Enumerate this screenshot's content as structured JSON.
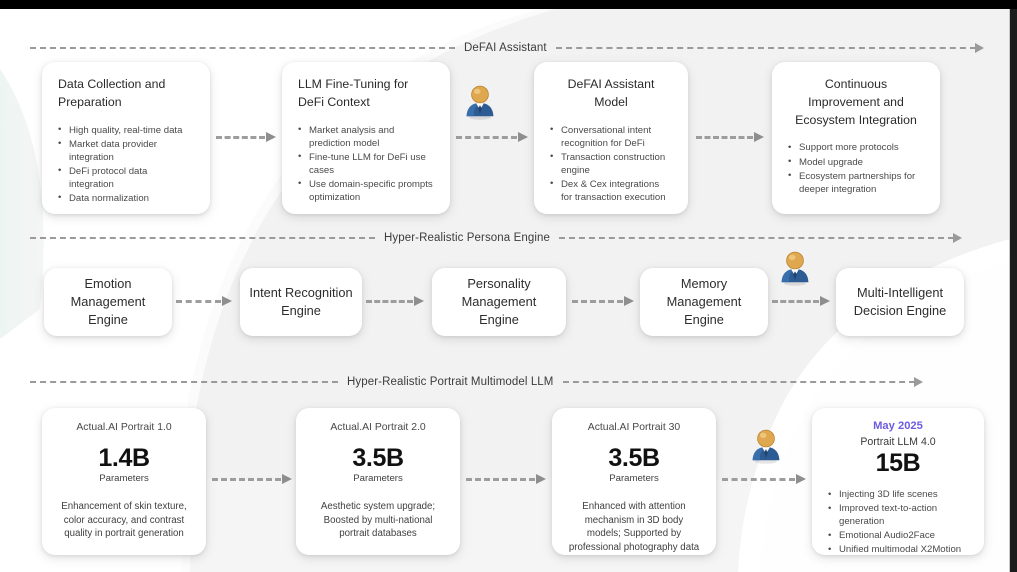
{
  "theme": {
    "background": "#f2f2f2",
    "card_background": "#ffffff",
    "accent_purple": "#6c5ce0",
    "arrow_gray": "#9a9a9a",
    "text_dark": "#2a2a2a"
  },
  "timelines": [
    {
      "label": "DeFAI Assistant"
    },
    {
      "label": "Hyper-Realistic Persona Engine"
    },
    {
      "label": "Hyper-Realistic Portrait Multimodel LLM"
    }
  ],
  "row1": {
    "cards": [
      {
        "title": "Data Collection and Preparation",
        "bullets": [
          "High quality, real-time data",
          "Market data provider integration",
          "DeFi protocol data integration",
          "Data normalization"
        ]
      },
      {
        "title": "LLM Fine-Tuning for DeFi Context",
        "bullets": [
          "Market analysis and prediction model",
          "Fine-tune LLM for DeFi use cases",
          "Use domain-specific prompts optimization"
        ]
      },
      {
        "title": "DeFAI Assistant Model",
        "bullets": [
          "Conversational intent recognition for DeFi",
          "Transaction construction engine",
          "Dex & Cex integrations for transaction execution"
        ]
      },
      {
        "title": "Continuous Improvement and Ecosystem Integration",
        "bullets": [
          "Support more protocols",
          "Model upgrade",
          "Ecosystem partnerships for deeper integration"
        ]
      }
    ]
  },
  "row2": {
    "cards": [
      {
        "label": "Emotion Management Engine"
      },
      {
        "label": "Intent Recognition Engine"
      },
      {
        "label": "Personality Management Engine"
      },
      {
        "label": "Memory Management Engine"
      },
      {
        "label": "Multi-Intelligent Decision Engine"
      }
    ]
  },
  "row3": {
    "cards": [
      {
        "head": "Actual.AI Portrait 1.0",
        "number": "1.4B",
        "params": "Parameters",
        "desc": "Enhancement of skin texture, color accuracy, and contrast quality in portrait generation"
      },
      {
        "head": "Actual.AI Portrait 2.0",
        "number": "3.5B",
        "params": "Parameters",
        "desc": "Aesthetic system upgrade; Boosted by multi-national portrait databases"
      },
      {
        "head": "Actual.AI Portrait 30",
        "number": "3.5B",
        "params": "Parameters",
        "desc": "Enhanced with attention mechanism in 3D body models; Supported by professional photography data"
      },
      {
        "date": "May 2025",
        "sub": "Portrait LLM 4.0",
        "number": "15B",
        "bullets": [
          "Injecting 3D life scenes",
          "Improved text-to-action generation",
          "Emotional Audio2Face",
          "Unified multimodal X2Motion"
        ]
      }
    ]
  },
  "avatars": [
    {
      "name": "businessman-avatar-row1"
    },
    {
      "name": "businessman-avatar-row2"
    },
    {
      "name": "businessman-avatar-row3"
    }
  ]
}
